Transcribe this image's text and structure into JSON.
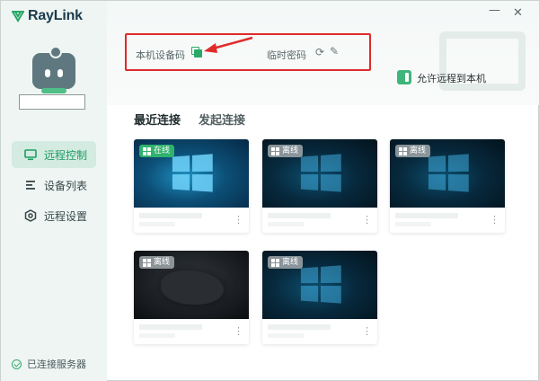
{
  "app": {
    "name": "RayLink"
  },
  "window": {
    "minimize": "—",
    "close": "✕"
  },
  "sidebar": {
    "items": [
      {
        "label": "远程控制",
        "icon": "monitor-icon",
        "active": true
      },
      {
        "label": "设备列表",
        "icon": "list-icon",
        "active": false
      },
      {
        "label": "远程设置",
        "icon": "settings-icon",
        "active": false
      }
    ],
    "status": "已连接服务器"
  },
  "device_info": {
    "device_code_label": "本机设备码",
    "temp_password_label": "临时密码"
  },
  "allow_remote": {
    "label": "允许远程到本机",
    "enabled": true
  },
  "tabs": [
    {
      "label": "最近连接",
      "active": true
    },
    {
      "label": "发起连接",
      "active": false
    }
  ],
  "devices": [
    {
      "status": "在线",
      "online": true,
      "os": "windows"
    },
    {
      "status": "离线",
      "online": false,
      "os": "windows"
    },
    {
      "status": "离线",
      "online": false,
      "os": "windows"
    },
    {
      "status": "离线",
      "online": false,
      "os": "other"
    },
    {
      "status": "离线",
      "online": false,
      "os": "windows"
    }
  ],
  "colors": {
    "accent": "#2aa86a",
    "highlight": "#e12a2a",
    "sidebar_bg": "#eef5f2",
    "offline_badge": "#a0a8ac"
  }
}
